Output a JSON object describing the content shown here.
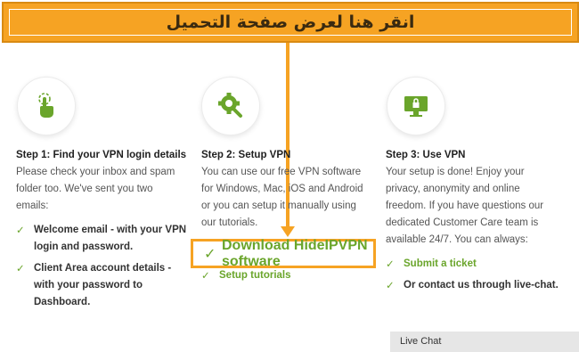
{
  "banner": {
    "text": "انقر هنا لعرض صفحة التحميل"
  },
  "steps": [
    {
      "icon": "hand-pointer-icon",
      "title": "Step 1: Find your VPN login details",
      "desc_lines": [
        "Please check your inbox and spam",
        "folder too. We've sent you two",
        "emails:"
      ],
      "items": [
        {
          "lines": [
            "Welcome email - with your VPN",
            "login and password."
          ]
        },
        {
          "lines": [
            "Client Area account details -",
            "with your password to",
            "Dashboard."
          ]
        }
      ]
    },
    {
      "icon": "gear-wrench-icon",
      "title": "Step 2: Setup VPN",
      "desc_lines": [
        "You can use our free VPN software",
        "for Windows, Mac, iOS and Android",
        "or you can setup it manually using",
        "our tutorials."
      ],
      "items": [
        {
          "text": "Download HideIPVPN software"
        },
        {
          "text": "Setup tutorials"
        }
      ]
    },
    {
      "icon": "monitor-lock-icon",
      "title": "Step 3: Use VPN",
      "desc_lines": [
        "Your setup is done! Enjoy your",
        "privacy, anonymity and online",
        "freedom. If you have questions our",
        "dedicated Customer Care team is",
        "available 24/7. You can always:"
      ],
      "items": [
        {
          "text": "Submit a ticket"
        },
        {
          "text": "Or contact us through live-chat."
        }
      ]
    }
  ],
  "check_glyph": "✓",
  "live_chat": {
    "label": "Live Chat"
  },
  "colors": {
    "accent": "#f6a323",
    "green": "#6aa52b"
  }
}
